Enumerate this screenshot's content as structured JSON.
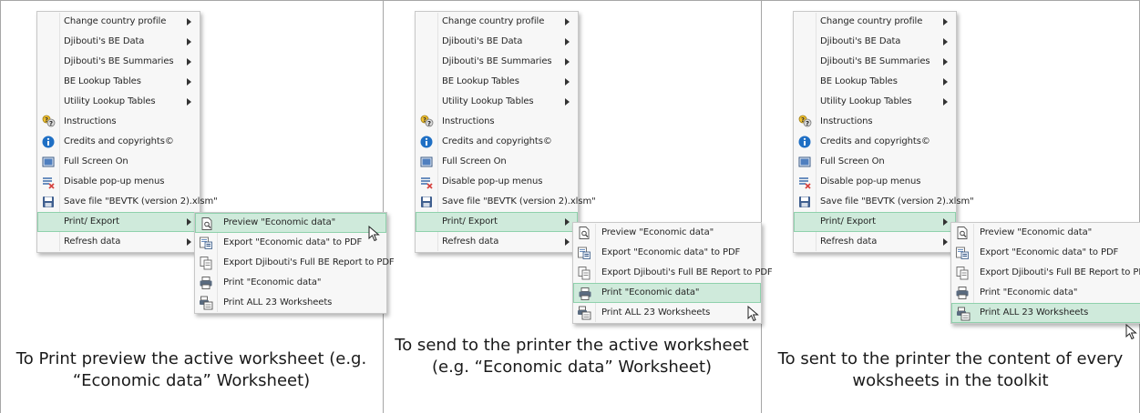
{
  "main_menu": [
    {
      "label": "Change country profile",
      "submenu": true,
      "icon": ""
    },
    {
      "label": "Djibouti's BE Data",
      "submenu": true,
      "icon": ""
    },
    {
      "label": "Djibouti's BE Summaries",
      "submenu": true,
      "icon": ""
    },
    {
      "label": "BE Lookup Tables",
      "submenu": true,
      "icon": ""
    },
    {
      "label": "Utility Lookup Tables",
      "submenu": true,
      "icon": ""
    },
    {
      "label": "Instructions",
      "submenu": false,
      "icon": "help-icon"
    },
    {
      "label": "Credits and copyrights©",
      "submenu": false,
      "icon": "info-icon"
    },
    {
      "label": "Full Screen On",
      "submenu": false,
      "icon": "fullscreen-icon"
    },
    {
      "label": "Disable pop-up menus",
      "submenu": false,
      "icon": "disable-menu-icon"
    },
    {
      "label": "Save file \"BEVTK (version 2).xlsm\"",
      "submenu": false,
      "icon": "save-icon"
    },
    {
      "label": "Print/ Export",
      "submenu": true,
      "icon": ""
    },
    {
      "label": "Refresh data",
      "submenu": true,
      "icon": ""
    }
  ],
  "submenu": [
    {
      "label": "Preview \"Economic data\"",
      "icon": "print-preview-icon"
    },
    {
      "label": "Export \"Economic data\" to PDF",
      "icon": "export-pdf-icon"
    },
    {
      "label": "Export Djibouti's Full BE Report to PDF",
      "icon": "export-report-icon"
    },
    {
      "label": "Print \"Economic data\"",
      "icon": "printer-icon"
    },
    {
      "label": "Print ALL 23 Worksheets",
      "icon": "print-all-icon"
    }
  ],
  "panels": [
    {
      "caption": "To Print preview the active worksheet (e.g. “Economic data” Worksheet)",
      "highlighted_submenu_item": 0
    },
    {
      "caption": "To send to the printer the active worksheet (e.g. “Economic data” Worksheet)",
      "highlighted_submenu_item": 3
    },
    {
      "caption": "To sent to the printer the content of every woksheets in the toolkit",
      "highlighted_submenu_item": 4
    }
  ],
  "colors": {
    "highlight_bg": "#cfeadb",
    "highlight_border": "#8fd1ac",
    "menu_bg": "#f7f7f7",
    "info_blue": "#1f6fc4",
    "delete_red": "#d64541"
  }
}
